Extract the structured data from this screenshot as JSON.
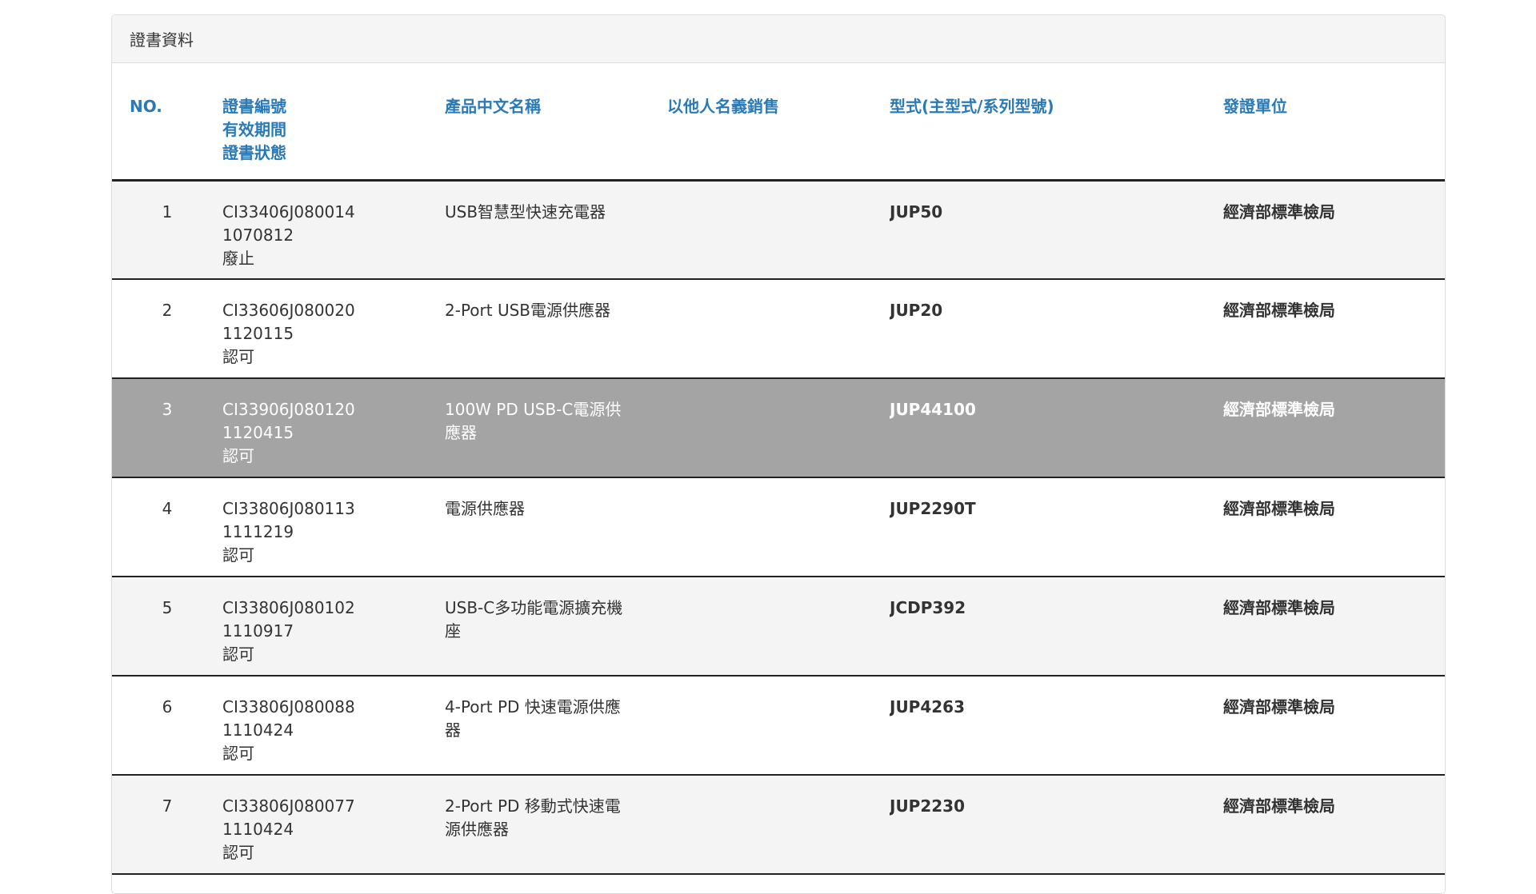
{
  "panel": {
    "title": "證書資料"
  },
  "columns": {
    "no": "NO.",
    "cert_no": "證書編號",
    "validity": "有效期間",
    "status": "證書狀態",
    "product_name": "產品中文名稱",
    "other_name": "以他人名義銷售",
    "model": "型式(主型式/系列型號)",
    "agency": "發證單位"
  },
  "rows": [
    {
      "no": "1",
      "cert_no": "CI33406J080014",
      "validity": "1070812",
      "status": "廢止",
      "name_line1": "USB智慧型快速充電器",
      "name_line2": "",
      "other": "",
      "model": "JUP50",
      "agency": "經濟部標準檢局"
    },
    {
      "no": "2",
      "cert_no": "CI33606J080020",
      "validity": "1120115",
      "status": "認可",
      "name_line1": "2-Port USB電源供應器",
      "name_line2": "",
      "other": "",
      "model": "JUP20",
      "agency": "經濟部標準檢局"
    },
    {
      "no": "3",
      "cert_no": "CI33906J080120",
      "validity": "1120415",
      "status": "認可",
      "name_line1": "100W PD USB-C電源供",
      "name_line2": "應器",
      "other": "",
      "model": "JUP44100",
      "agency": "經濟部標準檢局"
    },
    {
      "no": "4",
      "cert_no": "CI33806J080113",
      "validity": "1111219",
      "status": "認可",
      "name_line1": "電源供應器",
      "name_line2": "",
      "other": "",
      "model": "JUP2290T",
      "agency": "經濟部標準檢局"
    },
    {
      "no": "5",
      "cert_no": "CI33806J080102",
      "validity": "1110917",
      "status": "認可",
      "name_line1": "USB-C多功能電源擴充機",
      "name_line2": "座",
      "other": "",
      "model": "JCDP392",
      "agency": "經濟部標準檢局"
    },
    {
      "no": "6",
      "cert_no": "CI33806J080088",
      "validity": "1110424",
      "status": "認可",
      "name_line1": "4-Port PD 快速電源供應",
      "name_line2": "器",
      "other": "",
      "model": "JUP4263",
      "agency": "經濟部標準檢局"
    },
    {
      "no": "7",
      "cert_no": "CI33806J080077",
      "validity": "1110424",
      "status": "認可",
      "name_line1": "2-Port PD 移動式快速電",
      "name_line2": "源供應器",
      "other": "",
      "model": "JUP2230",
      "agency": "經濟部標準檢局"
    }
  ],
  "colors": {
    "header_text": "#2a7ab8",
    "highlight_row": "#a4a4a4",
    "striped_row": "#f4f4f4"
  }
}
